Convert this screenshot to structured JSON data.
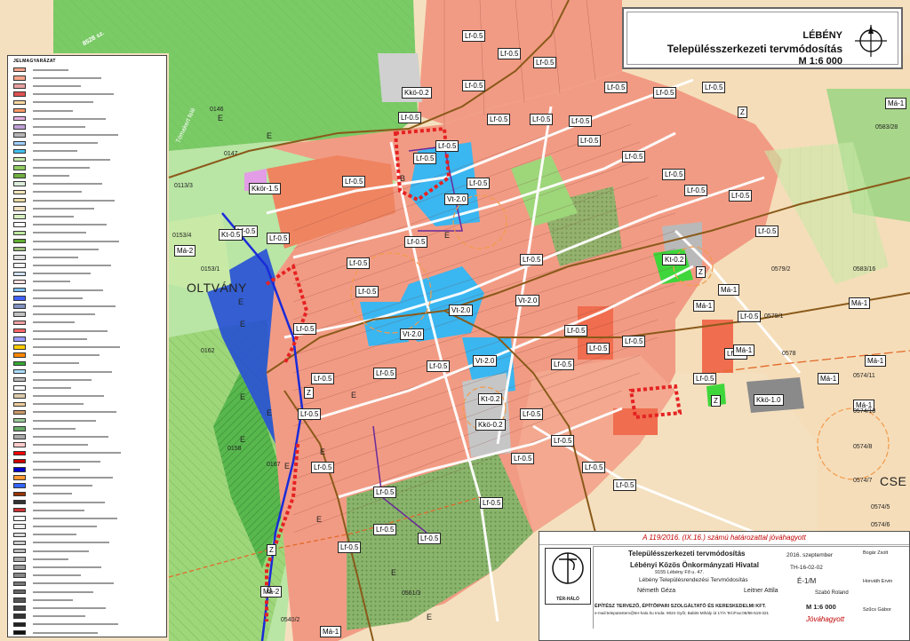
{
  "title": {
    "settlement": "LÉBÉNY",
    "plan": "Településszerkezeti tervmódosítás",
    "scale": "M 1:6 000"
  },
  "legend": {
    "heading": "JELMAGYARÁZAT",
    "colors": [
      "#f5a58a",
      "#f5a58a",
      "#e8a0a0",
      "#e05050",
      "#ffd9a0",
      "#ff9966",
      "#e6b0e0",
      "#c0a0d8",
      "#b6b6b6",
      "#a0d0ff",
      "#40c0f0",
      "#c8ecb0",
      "#90cc60",
      "#70b040",
      "#ddeedd",
      "#f3e7b8",
      "#e8d8a0",
      "#f0e0c0",
      "#d8f0c0",
      "#ffffff",
      "#c0e8a0",
      "#60b030",
      "#a0c080",
      "#e0e0e0",
      "#f4f4f4",
      "#d0e0f0",
      "#ffe0e0",
      "#80c0ff",
      "#4060ff",
      "#8090c0",
      "#c0c0c0",
      "#f0a0a0",
      "#ff6666",
      "#9999ff",
      "#ffcc00",
      "#ff8800",
      "#33aa33",
      "#aaddff",
      "#bbbbbb",
      "#ffffff",
      "#ddccaa",
      "#eecc99",
      "#cc9966",
      "#99cc99",
      "#66aa66",
      "#aaaaaa",
      "#ffcccc",
      "#ff0000",
      "#cc0000",
      "#0000cc",
      "#ff9933",
      "#3366ff",
      "#993300",
      "#333333",
      "#cc3333",
      "#ffffff",
      "#eeeeee",
      "#dddddd",
      "#cccccc",
      "#bbbbbb",
      "#aaaaaa",
      "#999999",
      "#888888",
      "#777777",
      "#666666",
      "#555555",
      "#444444",
      "#333333",
      "#222222",
      "#111111"
    ]
  },
  "map_labels": [
    {
      "t": "Lf-0.5"
    },
    {
      "t": "Lf-0.5"
    },
    {
      "t": "Lf-0.5"
    },
    {
      "t": "Lf-0.5"
    },
    {
      "t": "Lf-0.5"
    },
    {
      "t": "Lf-0.5"
    },
    {
      "t": "Lf-0.5"
    },
    {
      "t": "Lf-0.5"
    },
    {
      "t": "Lf-0.5"
    },
    {
      "t": "Lf-0.5"
    },
    {
      "t": "Lf-0.5"
    },
    {
      "t": "Lf-0.5"
    },
    {
      "t": "Lf-0.5"
    },
    {
      "t": "Lf-0.5"
    },
    {
      "t": "Lf-0.5"
    },
    {
      "t": "Lf-0.5"
    },
    {
      "t": "Lf-0.5"
    },
    {
      "t": "Lf-0.5"
    },
    {
      "t": "Lf-0.5"
    },
    {
      "t": "Lf-0.5"
    },
    {
      "t": "Lf-0.5"
    },
    {
      "t": "Lf-0.5"
    },
    {
      "t": "Lf-0.5"
    },
    {
      "t": "Lf-0.5"
    },
    {
      "t": "Lf-0.5"
    },
    {
      "t": "Lf-0.5"
    },
    {
      "t": "Lf-0.5"
    },
    {
      "t": "Lf-0.5"
    },
    {
      "t": "Lf-0.5"
    },
    {
      "t": "Lf-0.5"
    },
    {
      "t": "Lf-0.5"
    },
    {
      "t": "Lf-0.5"
    },
    {
      "t": "Lf-0.5"
    },
    {
      "t": "Lf-0.5"
    },
    {
      "t": "Lf-0.5"
    },
    {
      "t": "Lf-0.5"
    },
    {
      "t": "Lf-0.5"
    },
    {
      "t": "Lf-0.5"
    },
    {
      "t": "Lf-0.5"
    },
    {
      "t": "Lf-0.5"
    },
    {
      "t": "Lf-0.5"
    },
    {
      "t": "Lf-0.5"
    },
    {
      "t": "Lf-0.5"
    },
    {
      "t": "Lf-0.5"
    },
    {
      "t": "Lf-0.5"
    },
    {
      "t": "Lf-0.5"
    },
    {
      "t": "Lf-0.5"
    },
    {
      "t": "Lf-0.5"
    },
    {
      "t": "Lf-0.5"
    },
    {
      "t": "Lf-0.5"
    },
    {
      "t": "Vt-2.0"
    },
    {
      "t": "Vt-2.0"
    },
    {
      "t": "Vt-2.0"
    },
    {
      "t": "Vt-2.0"
    },
    {
      "t": "Vt-2.0"
    },
    {
      "t": "Kkö-0.2"
    },
    {
      "t": "Kkö-0.2"
    },
    {
      "t": "Kt-0.2"
    },
    {
      "t": "Kt-0.5"
    },
    {
      "t": "Kt-0.2"
    },
    {
      "t": "Kkö-1.0"
    },
    {
      "t": "Kkör-1.5"
    },
    {
      "t": "Má-1"
    },
    {
      "t": "Má-1"
    },
    {
      "t": "Má-1"
    },
    {
      "t": "Má-1"
    },
    {
      "t": "Má-1"
    },
    {
      "t": "Má-1"
    },
    {
      "t": "Má-1"
    },
    {
      "t": "Má-2"
    },
    {
      "t": "Má-2"
    },
    {
      "t": "Má-1"
    },
    {
      "t": "Má-1"
    },
    {
      "t": "Má-1"
    },
    {
      "t": "Z"
    },
    {
      "t": "Z"
    },
    {
      "t": "Z"
    },
    {
      "t": "Z"
    },
    {
      "t": "Z"
    },
    {
      "t": "E"
    },
    {
      "t": "E"
    },
    {
      "t": "E"
    },
    {
      "t": "E"
    },
    {
      "t": "E"
    },
    {
      "t": "E"
    },
    {
      "t": "E"
    },
    {
      "t": "E"
    },
    {
      "t": "E"
    },
    {
      "t": "E"
    },
    {
      "t": "E"
    },
    {
      "t": "E"
    },
    {
      "t": "E"
    },
    {
      "t": "E"
    },
    {
      "t": "B"
    },
    {
      "t": "B"
    }
  ],
  "place_names": {
    "oltvany": "OLTVÁNY",
    "cse": "CSE",
    "parcels": [
      "0146",
      "0147",
      "0153/1",
      "0153/4",
      "0162",
      "0158",
      "0167",
      "0579/2",
      "0579/1",
      "0583/16",
      "0578",
      "0574/11",
      "0574/10",
      "0574/8",
      "0574/7",
      "0574/5",
      "0574/6",
      "0561/3",
      "0540/2",
      "0113/3",
      "0583/28"
    ],
    "road_1": "8528 sz.",
    "road_2": "Tómakert felé"
  },
  "stamp": {
    "approval": "A 119/2016. (IX.16.) számú határozattal jóváhagyott",
    "logo": "TÉR-HÁLÓ",
    "project": "Településszerkezeti tervmódosítás",
    "date": "2016. szeptember",
    "client": "Lébényi Közös Önkormányzati Hivatal",
    "client_address": "9155 Lébény Fő u. 47.",
    "code": "TH-16-02-02",
    "subject": "Lébény Településrendezési Tervmódosítás",
    "sheet": "É-1/M",
    "designer1": "Németh Géza",
    "designer2": "Leitner Attila",
    "designer3": "Szabó Roland",
    "company": "ÉPÍTÉSZ TERVEZŐ, ÉPÍTŐIPARI SZOLGÁLTATÓ ÉS KERESKEDELMI KFT.",
    "company_contact": "e-mail:teleputesterv@ter-halo.hu Iroda: 9024 Győr, Babits Mihály út 17/A Tel./Fax:06/96-519-321",
    "scale": "M 1:6 000",
    "status": "Jóváhagyott",
    "sign1": "Bogár Zsolt",
    "sign2": "Horváth Ervin",
    "sign3": "Szűcs Gábor"
  }
}
